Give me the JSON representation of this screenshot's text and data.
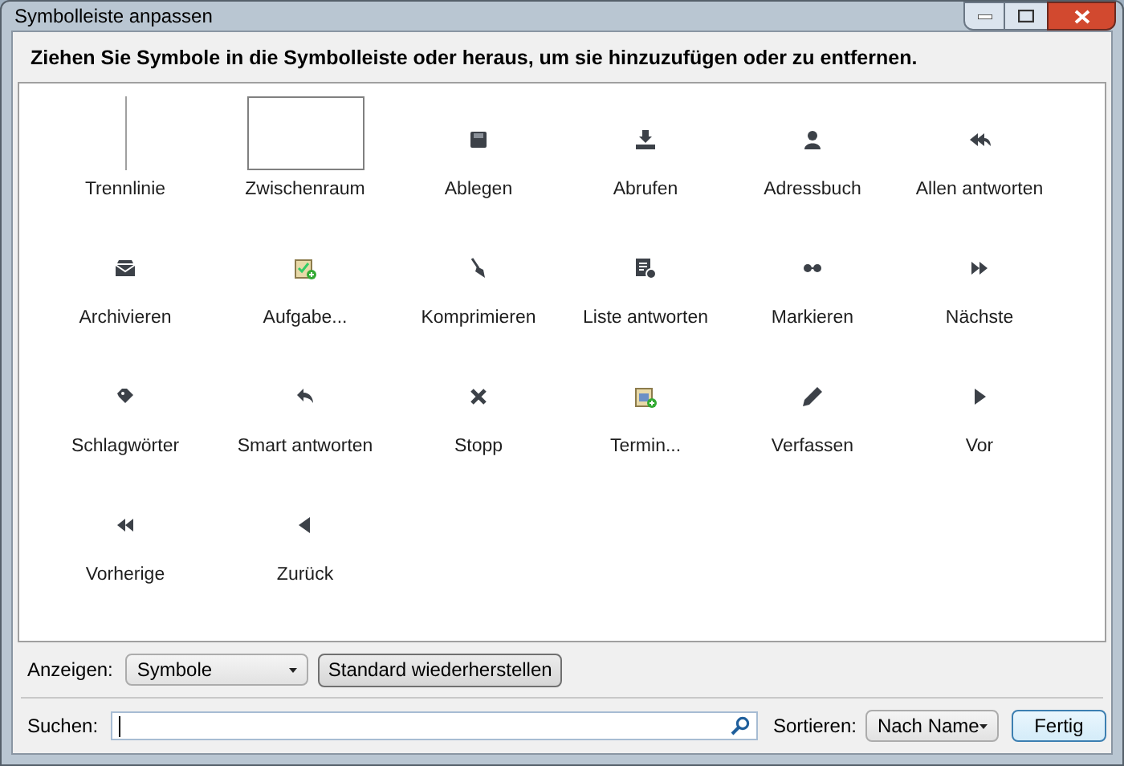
{
  "window": {
    "title": "Symbolleiste anpassen"
  },
  "instruction": "Ziehen Sie Symbole in die Symbolleiste oder heraus, um sie hinzuzufügen oder zu entfernen.",
  "items": [
    {
      "kind": "separator",
      "label": "Trennlinie"
    },
    {
      "kind": "space",
      "label": "Zwischenraum"
    },
    {
      "kind": "icon",
      "label": "Ablegen"
    },
    {
      "kind": "icon",
      "label": "Abrufen"
    },
    {
      "kind": "icon",
      "label": "Adressbuch"
    },
    {
      "kind": "icon",
      "label": "Allen antworten"
    },
    {
      "kind": "icon",
      "label": "Archivieren"
    },
    {
      "kind": "icon",
      "label": "Aufgabe..."
    },
    {
      "kind": "icon",
      "label": "Komprimieren"
    },
    {
      "kind": "icon",
      "label": "Liste antworten"
    },
    {
      "kind": "icon",
      "label": "Markieren"
    },
    {
      "kind": "icon",
      "label": "Nächste"
    },
    {
      "kind": "icon",
      "label": "Schlagwörter"
    },
    {
      "kind": "icon",
      "label": "Smart antworten"
    },
    {
      "kind": "icon",
      "label": "Stopp"
    },
    {
      "kind": "icon",
      "label": "Termin..."
    },
    {
      "kind": "icon",
      "label": "Verfassen"
    },
    {
      "kind": "icon",
      "label": "Vor"
    },
    {
      "kind": "icon",
      "label": "Vorherige"
    },
    {
      "kind": "icon",
      "label": "Zurück"
    }
  ],
  "show": {
    "label": "Anzeigen:",
    "value": "Symbole"
  },
  "restore_button": "Standard wiederherstellen",
  "search": {
    "label": "Suchen:"
  },
  "sort": {
    "label": "Sortieren:",
    "value": "Nach Name"
  },
  "done_button": "Fertig"
}
